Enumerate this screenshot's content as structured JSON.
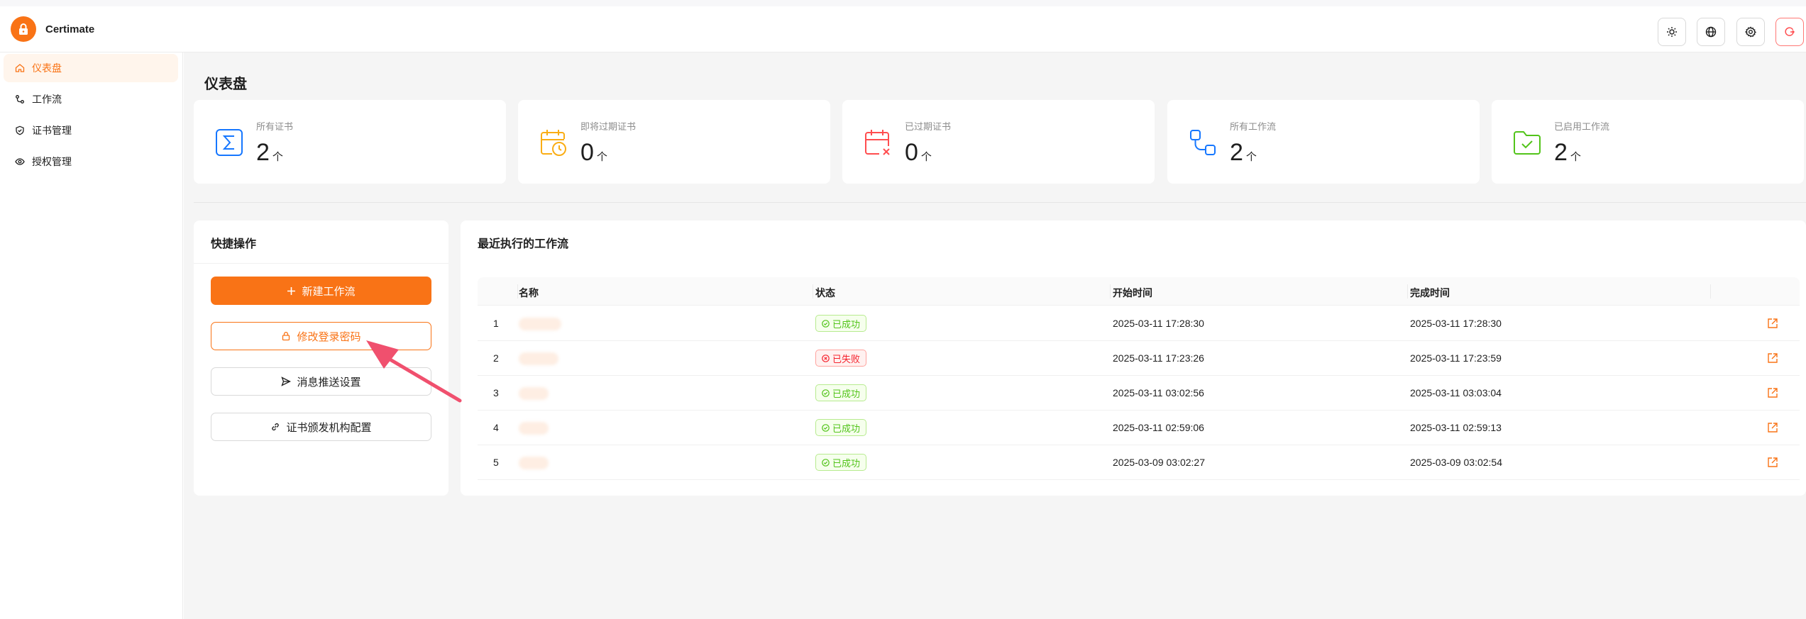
{
  "app": {
    "name": "Certimate"
  },
  "header": {
    "buttons": [
      {
        "name": "theme-toggle-button",
        "icon": "sun-icon"
      },
      {
        "name": "language-button",
        "icon": "globe-icon"
      },
      {
        "name": "settings-button",
        "icon": "gear-icon"
      },
      {
        "name": "logout-button",
        "icon": "logout-icon"
      }
    ]
  },
  "sidebar": {
    "items": [
      {
        "label": "仪表盘",
        "icon": "home-icon",
        "active": true
      },
      {
        "label": "工作流",
        "icon": "workflow-icon",
        "active": false
      },
      {
        "label": "证书管理",
        "icon": "shield-check-icon",
        "active": false
      },
      {
        "label": "授权管理",
        "icon": "eye-icon",
        "active": false
      }
    ]
  },
  "page": {
    "title": "仪表盘"
  },
  "stats": [
    {
      "label": "所有证书",
      "value": "2",
      "unit": "个",
      "icon": "sigma-icon",
      "color": "#1677ff"
    },
    {
      "label": "即将过期证书",
      "value": "0",
      "unit": "个",
      "icon": "calendar-clock-icon",
      "color": "#faad14"
    },
    {
      "label": "已过期证书",
      "value": "0",
      "unit": "个",
      "icon": "calendar-x-icon",
      "color": "#ff4d4f"
    },
    {
      "label": "所有工作流",
      "value": "2",
      "unit": "个",
      "icon": "workflow-icon",
      "color": "#1677ff"
    },
    {
      "label": "已启用工作流",
      "value": "2",
      "unit": "个",
      "icon": "folder-check-icon",
      "color": "#52c41a"
    }
  ],
  "quick_actions": {
    "title": "快捷操作",
    "buttons": [
      {
        "label": "新建工作流",
        "icon": "plus-icon",
        "style": "primary"
      },
      {
        "label": "修改登录密码",
        "icon": "lock-icon",
        "style": "outline"
      },
      {
        "label": "消息推送设置",
        "icon": "send-icon",
        "style": "default"
      },
      {
        "label": "证书颁发机构配置",
        "icon": "link-icon",
        "style": "default"
      }
    ]
  },
  "recent_workflows": {
    "title": "最近执行的工作流",
    "columns": [
      "名称",
      "状态",
      "开始时间",
      "完成时间"
    ],
    "rows": [
      {
        "index": "1",
        "status": "已成功",
        "status_type": "success",
        "start": "2025-03-11 17:28:30",
        "end": "2025-03-11 17:28:30"
      },
      {
        "index": "2",
        "status": "已失败",
        "status_type": "failure",
        "start": "2025-03-11 17:23:26",
        "end": "2025-03-11 17:23:59"
      },
      {
        "index": "3",
        "status": "已成功",
        "status_type": "success",
        "start": "2025-03-11 03:02:56",
        "end": "2025-03-11 03:03:04"
      },
      {
        "index": "4",
        "status": "已成功",
        "status_type": "success",
        "start": "2025-03-11 02:59:06",
        "end": "2025-03-11 02:59:13"
      },
      {
        "index": "5",
        "status": "已成功",
        "status_type": "success",
        "start": "2025-03-09 03:02:27",
        "end": "2025-03-09 03:02:54"
      }
    ]
  },
  "colors": {
    "accent": "#f97316",
    "success": "#52c41a",
    "danger": "#f5222d",
    "annotation_arrow": "#f0506e"
  }
}
